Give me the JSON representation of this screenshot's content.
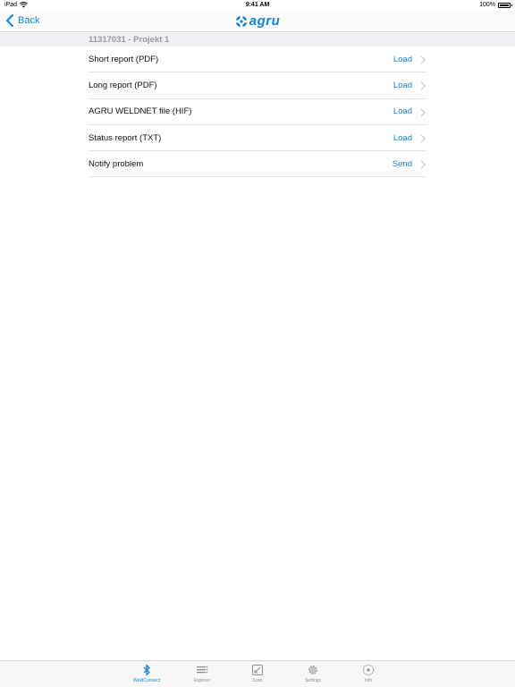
{
  "status_bar": {
    "device": "iPad",
    "time": "9:41 AM",
    "battery": "100%"
  },
  "nav": {
    "back_label": "Back",
    "logo_text": "agru"
  },
  "section": {
    "title": "11317031 - Projekt 1"
  },
  "rows": [
    {
      "label": "Short report (PDF)",
      "action": "Load"
    },
    {
      "label": "Long report (PDF)",
      "action": "Load"
    },
    {
      "label": "AGRU WELDNET file (HIF)",
      "action": "Load"
    },
    {
      "label": "Status report (TXT)",
      "action": "Load"
    },
    {
      "label": "Notify problem",
      "action": "Send"
    }
  ],
  "tabs": [
    {
      "label": "WeldConnect",
      "icon": "bluetooth-icon",
      "active": true
    },
    {
      "label": "Explorer",
      "icon": "list-icon",
      "active": false
    },
    {
      "label": "Scan",
      "icon": "scan-icon",
      "active": false
    },
    {
      "label": "Settings",
      "icon": "gear-icon",
      "active": false
    },
    {
      "label": "Info",
      "icon": "info-icon",
      "active": false
    }
  ],
  "colors": {
    "accent": "#1683d3",
    "inactive": "#8e8e93",
    "section_bg": "#efeff4"
  }
}
